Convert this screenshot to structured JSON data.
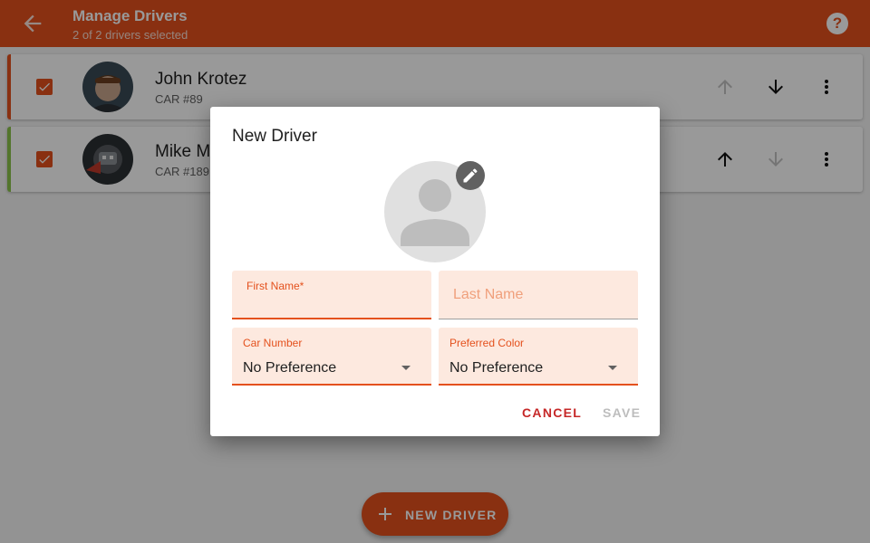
{
  "appbar": {
    "title": "Manage Drivers",
    "subtitle": "2 of 2 drivers selected",
    "help_glyph": "?",
    "back_icon": "arrow-back-icon",
    "help_icon": "help-icon"
  },
  "drivers": [
    {
      "name": "John Krotez",
      "car": "CAR #89",
      "accent": "#e4511d",
      "checked": true,
      "move_up_enabled": false,
      "move_down_enabled": true
    },
    {
      "name": "Mike M",
      "car": "CAR #189",
      "accent": "#8bc34a",
      "checked": true,
      "move_up_enabled": true,
      "move_down_enabled": false
    }
  ],
  "fab": {
    "label": "NEW DRIVER",
    "icon": "plus-icon"
  },
  "dialog": {
    "title": "New Driver",
    "photo_icon": "person-placeholder-icon",
    "edit_icon": "pencil-icon",
    "first_name": {
      "label": "First Name*",
      "value": ""
    },
    "last_name": {
      "placeholder": "Last Name",
      "value": ""
    },
    "car_number": {
      "label": "Car Number",
      "value": "No Preference"
    },
    "preferred_color": {
      "label": "Preferred Color",
      "value": "No Preference"
    },
    "cancel_label": "CANCEL",
    "save_label": "SAVE"
  },
  "colors": {
    "primary": "#e4511d",
    "field_bg": "#fde9df",
    "cancel": "#c62828",
    "disabled": "#bdbdbd"
  }
}
